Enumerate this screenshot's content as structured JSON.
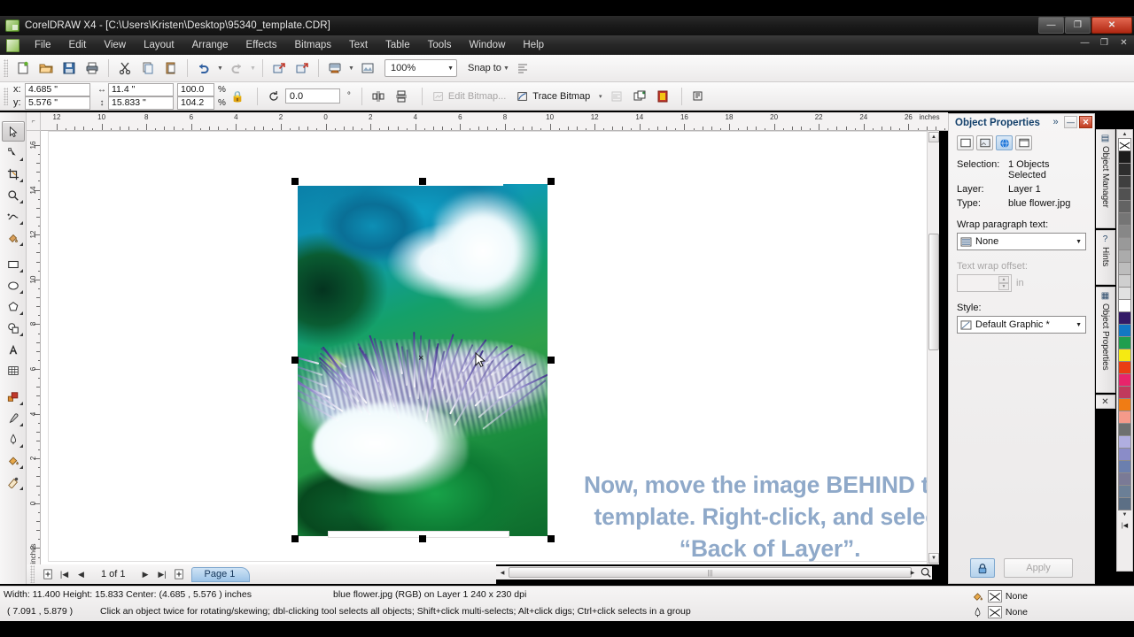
{
  "window": {
    "title": "CorelDRAW X4 - [C:\\Users\\Kristen\\Desktop\\95340_template.CDR]",
    "app_icon": "coreldraw-icon",
    "minimize": "—",
    "maximize": "❐",
    "close": "✕",
    "doc_minimize": "—",
    "doc_restore": "❐",
    "doc_close": "✕"
  },
  "menu": {
    "doc_icon": "document-icon",
    "items": [
      {
        "label": "File"
      },
      {
        "label": "Edit"
      },
      {
        "label": "View"
      },
      {
        "label": "Layout"
      },
      {
        "label": "Arrange"
      },
      {
        "label": "Effects"
      },
      {
        "label": "Bitmaps"
      },
      {
        "label": "Text"
      },
      {
        "label": "Table"
      },
      {
        "label": "Tools"
      },
      {
        "label": "Window"
      },
      {
        "label": "Help"
      }
    ]
  },
  "standard_toolbar": {
    "buttons": [
      {
        "name": "new-document",
        "icon": "new-page-icon"
      },
      {
        "name": "open-document",
        "icon": "folder-open-icon"
      },
      {
        "name": "save-document",
        "icon": "floppy-save-icon"
      },
      {
        "name": "print-document",
        "icon": "printer-icon"
      },
      {
        "name": "cut",
        "icon": "scissors-icon"
      },
      {
        "name": "copy",
        "icon": "copy-icon"
      },
      {
        "name": "paste",
        "icon": "clipboard-paste-icon"
      },
      {
        "name": "undo",
        "icon": "undo-arrow-icon"
      },
      {
        "name": "redo",
        "icon": "redo-arrow-icon"
      },
      {
        "name": "import",
        "icon": "import-icon"
      },
      {
        "name": "export",
        "icon": "export-icon"
      },
      {
        "name": "application-launcher",
        "icon": "monitor-icon"
      },
      {
        "name": "corel-online",
        "icon": "picture-icon"
      }
    ],
    "zoom_level": "100%",
    "snap_to_label": "Snap to",
    "options_icon": "options-icon"
  },
  "property_bar": {
    "x_label": "x:",
    "y_label": "y:",
    "x_value": "4.685 \"",
    "y_value": "5.576 \"",
    "width_value": "11.4 \"",
    "height_value": "15.833 \"",
    "width_icon": "horizontal-size-icon",
    "height_icon": "vertical-size-icon",
    "scale_h": "100.0",
    "scale_v": "104.2",
    "percent_sign": "%",
    "lock_ratio_icon": "lock-ratio-icon",
    "rotation_icon": "rotate-icon",
    "rotation_value": "0.0",
    "degree_sign": "°",
    "mirror_h_icon": "mirror-horizontal-icon",
    "mirror_v_icon": "mirror-vertical-icon",
    "edit_bitmap_label": "Edit Bitmap...",
    "edit_bitmap_icon": "edit-bitmap-icon",
    "trace_bitmap_label": "Trace Bitmap",
    "trace_bitmap_icon": "trace-bitmap-icon",
    "wrap_icon": "wrap-paragraph-icon",
    "to_front_icon": "to-front-icon",
    "bitmap_color_mask_icon": "bitmap-color-mask-icon",
    "text_wrap_icon": "text-wrap-icon"
  },
  "toolbox": [
    {
      "name": "pick-tool",
      "icon": "arrow-cursor-icon",
      "active": true,
      "flyout": false
    },
    {
      "name": "shape-tool",
      "icon": "shape-node-icon",
      "active": false,
      "flyout": true
    },
    {
      "name": "crop-tool",
      "icon": "crop-icon",
      "active": false,
      "flyout": true
    },
    {
      "name": "zoom-tool",
      "icon": "magnifier-icon",
      "active": false,
      "flyout": true
    },
    {
      "name": "freehand-tool",
      "icon": "freehand-curve-icon",
      "active": false,
      "flyout": true
    },
    {
      "name": "smart-fill-tool",
      "icon": "smart-fill-icon",
      "active": false,
      "flyout": true
    },
    {
      "name": "rectangle-tool",
      "icon": "rectangle-icon",
      "active": false,
      "flyout": true
    },
    {
      "name": "ellipse-tool",
      "icon": "ellipse-icon",
      "active": false,
      "flyout": true
    },
    {
      "name": "polygon-tool",
      "icon": "polygon-icon",
      "active": false,
      "flyout": true
    },
    {
      "name": "basic-shapes-tool",
      "icon": "basic-shapes-icon",
      "active": false,
      "flyout": true
    },
    {
      "name": "text-tool",
      "icon": "text-a-icon",
      "active": false,
      "flyout": false
    },
    {
      "name": "table-tool",
      "icon": "table-grid-icon",
      "active": false,
      "flyout": false
    },
    {
      "name": "blend-tool",
      "icon": "blend-icon",
      "active": false,
      "flyout": true
    },
    {
      "name": "eyedropper-tool",
      "icon": "eyedropper-icon",
      "active": false,
      "flyout": true
    },
    {
      "name": "outline-tool",
      "icon": "outline-pen-icon",
      "active": false,
      "flyout": true
    },
    {
      "name": "fill-tool",
      "icon": "fill-bucket-icon",
      "active": false,
      "flyout": true
    },
    {
      "name": "interactive-fill-tool",
      "icon": "interactive-fill-icon",
      "active": false,
      "flyout": true
    }
  ],
  "rulers": {
    "unit_label": "inches",
    "vertical_unit_label": "inches",
    "corner_icon": "ruler-origin-icon",
    "horizontal_labels": [
      "12",
      "10",
      "8",
      "6",
      "4",
      "2",
      "0",
      "2",
      "4",
      "6",
      "8",
      "10",
      "12",
      "14",
      "16",
      "18",
      "20",
      "22",
      "24",
      "26"
    ],
    "vertical_labels": [
      "16",
      "14",
      "12",
      "10",
      "8",
      "6",
      "4",
      "2",
      "0",
      "2"
    ]
  },
  "canvas": {
    "selected_object_name": "blue-flower-image",
    "center_marker": "×",
    "cursor": "arrow-cursor",
    "overlay_text_line1": "Now, move the image BEHIND the",
    "overlay_text_line2": "template. Right-click, and select",
    "overlay_text_line3": "“Back of Layer”.",
    "overlay_color": "#8fa9c9"
  },
  "page_navigator": {
    "add_page_start_icon": "add-page-icon",
    "first_icon": "|◀",
    "prev_icon": "◀",
    "count_label": "1 of 1",
    "next_icon": "▶",
    "last_icon": "▶|",
    "add_page_end_icon": "add-page-icon",
    "page_tab_label": "Page 1"
  },
  "docker": {
    "title": "Object Properties",
    "collapse_icon": "»",
    "minimize_icon": "—",
    "close_icon": "✕",
    "tabs": [
      {
        "name": "outline-tab",
        "icon": "outline-rect-icon",
        "selected": false
      },
      {
        "name": "fill-tab",
        "icon": "fill-preview-icon",
        "selected": false
      },
      {
        "name": "internet-tab",
        "icon": "globe-icon",
        "selected": true
      },
      {
        "name": "general-tab",
        "icon": "general-rect-icon",
        "selected": false
      }
    ],
    "selection_key": "Selection:",
    "selection_value": "1 Objects Selected",
    "layer_key": "Layer:",
    "layer_value": "Layer 1",
    "type_key": "Type:",
    "type_value": "blue flower.jpg",
    "wrap_label": "Wrap paragraph text:",
    "wrap_value": "None",
    "wrap_icon": "wrap-style-icon",
    "offset_label": "Text wrap offset:",
    "offset_value": "",
    "offset_unit": "in",
    "style_label": "Style:",
    "style_value": "Default Graphic *",
    "style_icon": "style-icon",
    "lock_button_icon": "lock-closed-icon",
    "apply_label": "Apply"
  },
  "vertical_tabs": [
    {
      "label": "Object Manager",
      "icon": "object-manager-icon"
    },
    {
      "label": "Hints",
      "icon": "hints-question-icon"
    },
    {
      "label": "Object Properties",
      "icon": "object-properties-icon"
    },
    {
      "label": "",
      "icon": "close-x-icon"
    }
  ],
  "palette": {
    "up_arrow": "▲",
    "down_arrow": "▼",
    "end_arrow": "|◀",
    "swatches": [
      "none",
      "#1c1c1c",
      "#2e2e2e",
      "#3f3f3f",
      "#515151",
      "#636363",
      "#757575",
      "#878787",
      "#999999",
      "#ababab",
      "#bdbdbd",
      "#cfcfcf",
      "#e1e1e1",
      "#ffffff",
      "#331a66",
      "#1277c4",
      "#1f9e4e",
      "#f5ea12",
      "#ea3d13",
      "#e8246b",
      "#c03a5c",
      "#f07c14",
      "#f59a8a",
      "#6e7070",
      "#b0aee0",
      "#8a8cc8",
      "#6b7fae",
      "#7a7a96",
      "#6b7f96",
      "#5c6f85"
    ]
  },
  "status_bar": {
    "dimensions_text": "Width: 11.400  Height: 15.833  Center: (4.685 , 5.576 )  inches",
    "object_text": "blue flower.jpg (RGB) on Layer 1 240 x 230 dpi",
    "coordinates": "( 7.091 , 5.879  )",
    "hint_text": "Click an object twice for rotating/skewing; dbl-clicking tool selects all objects; Shift+click multi-selects; Alt+click digs; Ctrl+click selects in a group",
    "fill_icon": "fill-bucket-icon",
    "fill_value": "None",
    "outline_icon": "outline-pen-icon",
    "outline_value": "None"
  }
}
